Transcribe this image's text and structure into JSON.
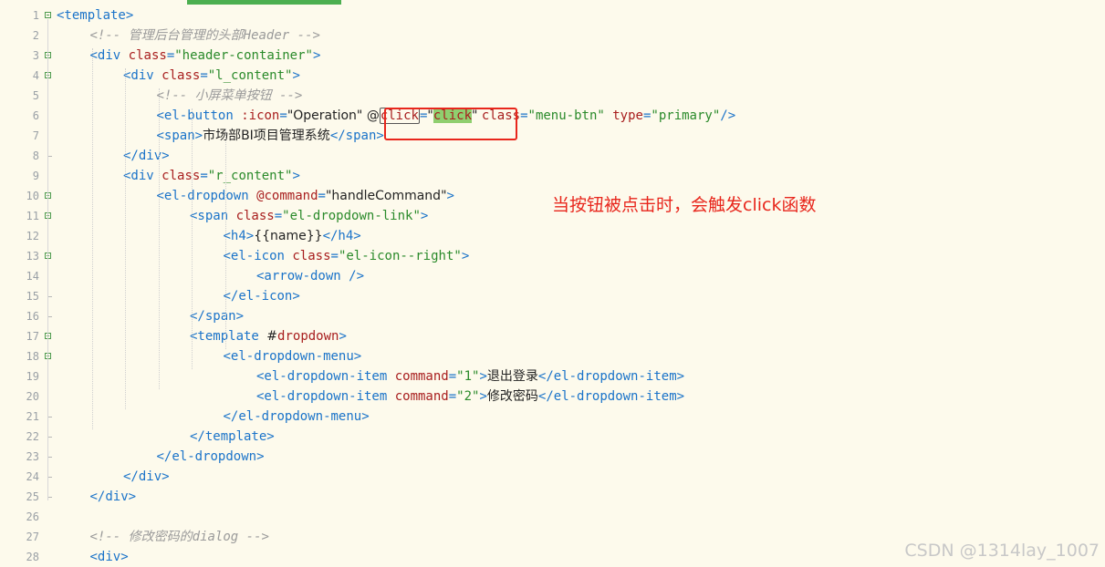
{
  "editor": {
    "line_numbers": [
      "1",
      "2",
      "3",
      "4",
      "5",
      "6",
      "7",
      "8",
      "9",
      "10",
      "11",
      "12",
      "13",
      "14",
      "15",
      "16",
      "17",
      "18",
      "19",
      "20",
      "21",
      "22",
      "23",
      "24",
      "25",
      "26",
      "27",
      "28"
    ],
    "lines": [
      [
        {
          "c": "tag",
          "t": "<template>"
        }
      ],
      [
        {
          "c": "cmt",
          "t": "<!-- 管理后台管理的头部Header -->"
        }
      ],
      [
        {
          "c": "tag",
          "t": "<div "
        },
        {
          "c": "attr",
          "t": "class"
        },
        {
          "c": "tag",
          "t": "="
        },
        {
          "c": "str",
          "t": "\"header-container\""
        },
        {
          "c": "tag",
          "t": ">"
        }
      ],
      [
        {
          "c": "tag",
          "t": "<div "
        },
        {
          "c": "attr",
          "t": "class"
        },
        {
          "c": "tag",
          "t": "="
        },
        {
          "c": "str",
          "t": "\"l_content\""
        },
        {
          "c": "tag",
          "t": ">"
        }
      ],
      [
        {
          "c": "cmt",
          "t": "<!-- 小屏菜单按钮 -->"
        }
      ],
      [
        {
          "c": "tag",
          "t": "<el-button "
        },
        {
          "c": "attr",
          "t": ":icon"
        },
        {
          "c": "tag",
          "t": "="
        },
        {
          "c": "txt",
          "t": "\"Operation\" @"
        },
        {
          "c": "attr word-box",
          "t": "click"
        },
        {
          "c": "tag",
          "t": "="
        },
        {
          "c": "txt",
          "t": "\""
        },
        {
          "c": "attr word-hl",
          "t": "click"
        },
        {
          "c": "txt",
          "t": "\" "
        },
        {
          "c": "attr",
          "t": "class"
        },
        {
          "c": "tag",
          "t": "="
        },
        {
          "c": "str",
          "t": "\"menu-btn\""
        },
        {
          "c": "tag",
          "t": " "
        },
        {
          "c": "attr",
          "t": "type"
        },
        {
          "c": "tag",
          "t": "="
        },
        {
          "c": "str",
          "t": "\"primary\""
        },
        {
          "c": "tag",
          "t": "/>"
        }
      ],
      [
        {
          "c": "tag",
          "t": "<span>"
        },
        {
          "c": "txt",
          "t": "市场部BI项目管理系统"
        },
        {
          "c": "tag",
          "t": "</span>"
        }
      ],
      [
        {
          "c": "tag",
          "t": "</div>"
        }
      ],
      [
        {
          "c": "tag",
          "t": "<div "
        },
        {
          "c": "attr",
          "t": "class"
        },
        {
          "c": "tag",
          "t": "="
        },
        {
          "c": "str",
          "t": "\"r_content\""
        },
        {
          "c": "tag",
          "t": ">"
        }
      ],
      [
        {
          "c": "tag",
          "t": "<el-dropdown "
        },
        {
          "c": "attr",
          "t": "@command"
        },
        {
          "c": "tag",
          "t": "="
        },
        {
          "c": "txt",
          "t": "\"handleCommand\""
        },
        {
          "c": "tag",
          "t": ">"
        }
      ],
      [
        {
          "c": "tag",
          "t": "<span "
        },
        {
          "c": "attr",
          "t": "class"
        },
        {
          "c": "tag",
          "t": "="
        },
        {
          "c": "str",
          "t": "\"el-dropdown-link\""
        },
        {
          "c": "tag",
          "t": ">"
        }
      ],
      [
        {
          "c": "tag",
          "t": "<h4>"
        },
        {
          "c": "txt",
          "t": "{{name}}"
        },
        {
          "c": "tag",
          "t": "</h4>"
        }
      ],
      [
        {
          "c": "tag",
          "t": "<el-icon "
        },
        {
          "c": "attr",
          "t": "class"
        },
        {
          "c": "tag",
          "t": "="
        },
        {
          "c": "str",
          "t": "\"el-icon--right\""
        },
        {
          "c": "tag",
          "t": ">"
        }
      ],
      [
        {
          "c": "tag",
          "t": "<arrow-down />"
        }
      ],
      [
        {
          "c": "tag",
          "t": "</el-icon>"
        }
      ],
      [
        {
          "c": "tag",
          "t": "</span>"
        }
      ],
      [
        {
          "c": "tag",
          "t": "<template "
        },
        {
          "c": "txt",
          "t": "#"
        },
        {
          "c": "attr",
          "t": "dropdown"
        },
        {
          "c": "tag",
          "t": ">"
        }
      ],
      [
        {
          "c": "tag",
          "t": "<el-dropdown-menu>"
        }
      ],
      [
        {
          "c": "tag",
          "t": "<el-dropdown-item "
        },
        {
          "c": "attr",
          "t": "command"
        },
        {
          "c": "tag",
          "t": "="
        },
        {
          "c": "str",
          "t": "\"1\""
        },
        {
          "c": "tag",
          "t": ">"
        },
        {
          "c": "txt",
          "t": "退出登录"
        },
        {
          "c": "tag",
          "t": "</el-dropdown-item>"
        }
      ],
      [
        {
          "c": "tag",
          "t": "<el-dropdown-item "
        },
        {
          "c": "attr",
          "t": "command"
        },
        {
          "c": "tag",
          "t": "="
        },
        {
          "c": "str",
          "t": "\"2\""
        },
        {
          "c": "tag",
          "t": ">"
        },
        {
          "c": "txt",
          "t": "修改密码"
        },
        {
          "c": "tag",
          "t": "</el-dropdown-item>"
        }
      ],
      [
        {
          "c": "tag",
          "t": "</el-dropdown-menu>"
        }
      ],
      [
        {
          "c": "tag",
          "t": "</template>"
        }
      ],
      [
        {
          "c": "tag",
          "t": "</el-dropdown>"
        }
      ],
      [
        {
          "c": "tag",
          "t": "</div>"
        }
      ],
      [
        {
          "c": "tag",
          "t": "</div>"
        }
      ],
      [],
      [
        {
          "c": "cmt",
          "t": "<!-- 修改密码的dialog -->"
        }
      ],
      [
        {
          "c": "tag",
          "t": "<div>"
        }
      ]
    ]
  },
  "annotation": "当按钮被点击时，会触发click函数",
  "watermark": "CSDN @1314lay_1007"
}
